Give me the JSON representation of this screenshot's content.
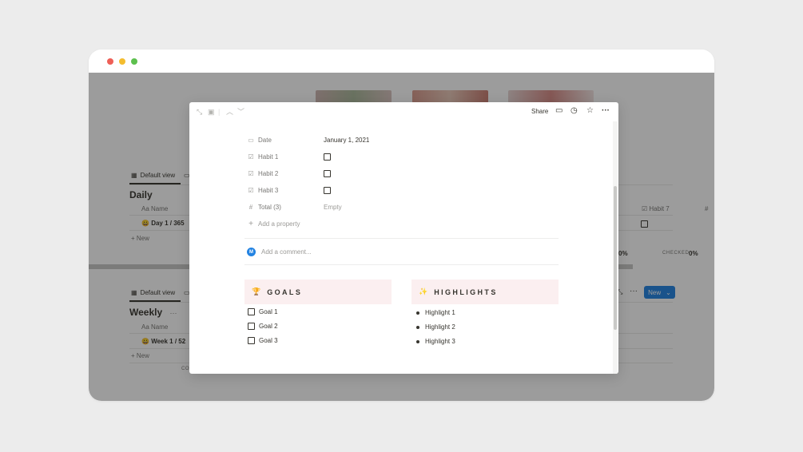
{
  "window": {
    "controls": [
      "close",
      "minimize",
      "maximize"
    ]
  },
  "background": {
    "daily": {
      "view_label": "Default view",
      "title": "Daily",
      "name_header": "Aa Name",
      "row_label": "Day 1 / 365",
      "row_emoji": "😀",
      "new_label": "+ New",
      "habit7_header": "Habit 7",
      "hash_header": "#",
      "stat_pct": "0%",
      "stat_label": "CHECKED",
      "stat_pct2": "0%"
    },
    "weekly": {
      "view_label": "Default view",
      "title": "Weekly",
      "more": "···",
      "name_header": "Aa Name",
      "row_label": "Week 1 / 52",
      "row_emoji": "😀",
      "new_label": "+ New",
      "footer_text": "CO",
      "new_button": "New",
      "more_icon": "···"
    }
  },
  "modal": {
    "toolbar": {
      "share": "Share"
    },
    "properties": [
      {
        "icon": "calendar-icon",
        "glyph": "▭",
        "name": "Date",
        "value": "January 1, 2021",
        "type": "text"
      },
      {
        "icon": "checkbox-icon",
        "glyph": "☑",
        "name": "Habit 1",
        "value": "",
        "type": "checkbox"
      },
      {
        "icon": "checkbox-icon",
        "glyph": "☑",
        "name": "Habit 2",
        "value": "",
        "type": "checkbox"
      },
      {
        "icon": "checkbox-icon",
        "glyph": "☑",
        "name": "Habit 3",
        "value": "",
        "type": "checkbox"
      },
      {
        "icon": "number-icon",
        "glyph": "#",
        "name": "Total (3)",
        "value": "Empty",
        "type": "empty"
      }
    ],
    "add_property": "Add a property",
    "comment": {
      "avatar": "M",
      "placeholder": "Add a comment..."
    },
    "goals": {
      "emoji": "🏆",
      "title": "GOALS",
      "items": [
        "Goal 1",
        "Goal 2",
        "Goal 3"
      ]
    },
    "highlights": {
      "emoji": "✨",
      "title": "HIGHLIGHTS",
      "items": [
        "Highlight 1",
        "Highlight 2",
        "Highlight 3"
      ]
    }
  },
  "colors": {
    "accent": "#2383e2",
    "callout_bg": "#fbeff0",
    "overlay": "rgba(15,15,15,0.41)"
  }
}
